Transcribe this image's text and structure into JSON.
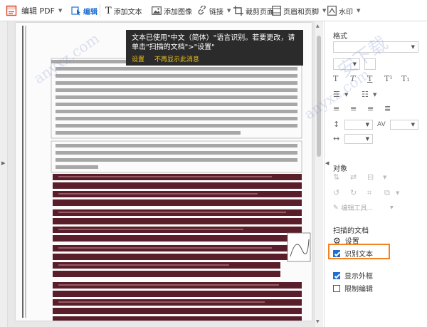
{
  "toolbar": {
    "panel_title": "编辑 PDF",
    "edit": "编辑",
    "add_text": "添加文本",
    "add_image": "添加图像",
    "link": "链接",
    "crop": "裁剪页面",
    "header_footer": "页眉和页脚",
    "watermark": "水印"
  },
  "tooltip": {
    "message": "文本已使用\"中文（简体）\"语言识别。若要更改，请单击\"扫描的文档\">\"设置\"",
    "settings": "设置",
    "dont_show": "不再显示此消息"
  },
  "panel": {
    "format_title": "格式",
    "objects_title": "对象",
    "edit_tools_label": "编辑工具...",
    "scanned_title": "扫描的文档",
    "settings_label": "设置",
    "recognize_text_label": "识别文本",
    "show_bbox_label": "显示外框",
    "restrict_edit_label": "限制编辑",
    "recognize_text_checked": true,
    "show_bbox_checked": true,
    "restrict_edit_checked": false
  },
  "watermark": {
    "text1": "anyxz.com",
    "text2": "安下载",
    "text3": "anyxz.com"
  },
  "colors": {
    "accent": "#1f6fd1",
    "highlight": "#f58220",
    "tooltip_bg": "#2b2b2b",
    "tooltip_link": "#f0c419",
    "redacted": "#5a1e2a"
  }
}
